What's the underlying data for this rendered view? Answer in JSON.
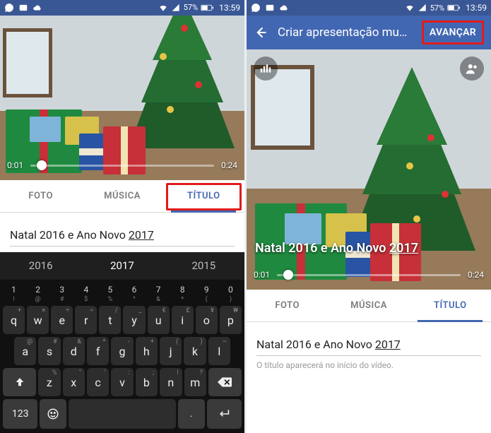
{
  "status": {
    "battery": "57%",
    "time": "13:59"
  },
  "left": {
    "video": {
      "current": "0:01",
      "total": "0:24"
    },
    "tabs": {
      "foto": "FOTO",
      "musica": "MÚSICA",
      "titulo": "TÍTULO"
    },
    "title_text_prefix": "Natal 2016 e Ano Novo ",
    "title_text_underlined": "2017",
    "suggestions": {
      "s1": "2016",
      "s2_selected": "2017",
      "s3": "2015"
    },
    "keyboard": {
      "nums": [
        "1",
        "2",
        "3",
        "4",
        "5",
        "6",
        "7",
        "8",
        "9",
        "0"
      ],
      "nsubs": [
        "!",
        "@",
        "#",
        "$",
        "%",
        "^",
        "&",
        "*",
        "(",
        ")"
      ],
      "row1": [
        "q",
        "w",
        "e",
        "r",
        "t",
        "y",
        "u",
        "i",
        "o",
        "p"
      ],
      "alt1": [
        "+",
        "×",
        "÷",
        "=",
        "/",
        "_",
        "€",
        "£",
        "¥",
        "₩"
      ],
      "row2": [
        "a",
        "s",
        "d",
        "f",
        "g",
        "h",
        "j",
        "k",
        "l"
      ],
      "alt2": [
        "@",
        "#",
        "&",
        "*",
        "-",
        "+",
        "(",
        ")",
        "~"
      ],
      "row3": [
        "z",
        "x",
        "c",
        "v",
        "b",
        "n",
        "m"
      ],
      "alt3": [
        "%",
        "\"",
        "'",
        ":",
        ";",
        "!",
        "?"
      ],
      "bottom": {
        "sym": "123",
        "langDot": ".",
        "enter": "↵"
      }
    }
  },
  "right": {
    "appbar": {
      "title": "Criar apresentação mu…",
      "advance": "AVANÇAR"
    },
    "video": {
      "current": "0:01",
      "total": "0:24"
    },
    "overlay_title_prefix": "Natal 2016 e Ano Novo ",
    "overlay_title_underlined": "2017",
    "tabs": {
      "foto": "FOTO",
      "musica": "MÚSICA",
      "titulo": "TÍTULO"
    },
    "title_text_prefix": "Natal 2016 e Ano Novo ",
    "title_text_underlined": "2017",
    "hint": "O título aparecerá no início do vídeo."
  }
}
